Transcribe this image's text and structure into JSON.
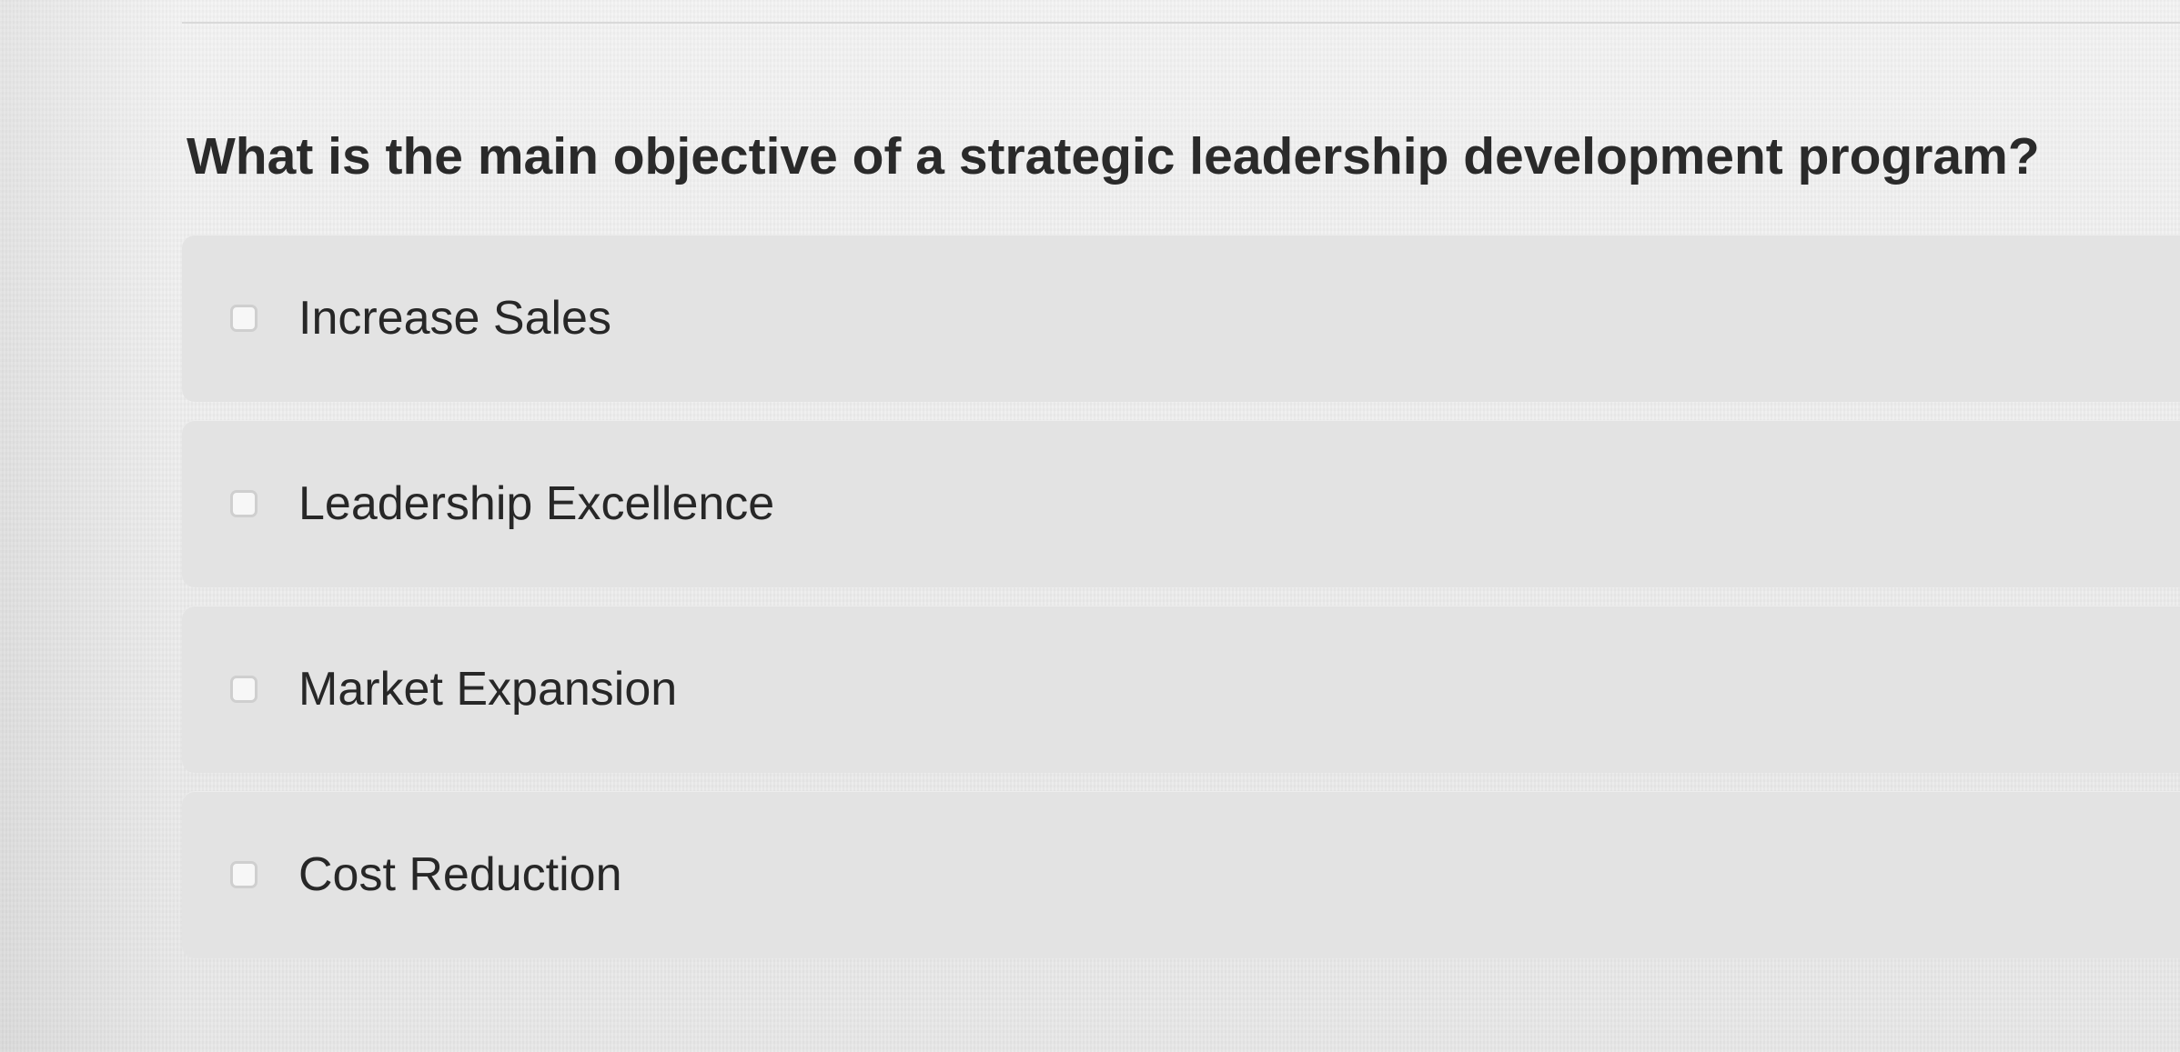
{
  "question": {
    "text": "What is the main objective of a strategic leadership development program?"
  },
  "options": [
    {
      "label": "Increase Sales",
      "checked": false
    },
    {
      "label": "Leadership Excellence",
      "checked": false
    },
    {
      "label": "Market Expansion",
      "checked": false
    },
    {
      "label": "Cost Reduction",
      "checked": false
    }
  ],
  "colors": {
    "background": "#ececec",
    "option_background": "#e3e3e3",
    "text": "#272727",
    "checkbox_border": "#cfcfcf"
  }
}
